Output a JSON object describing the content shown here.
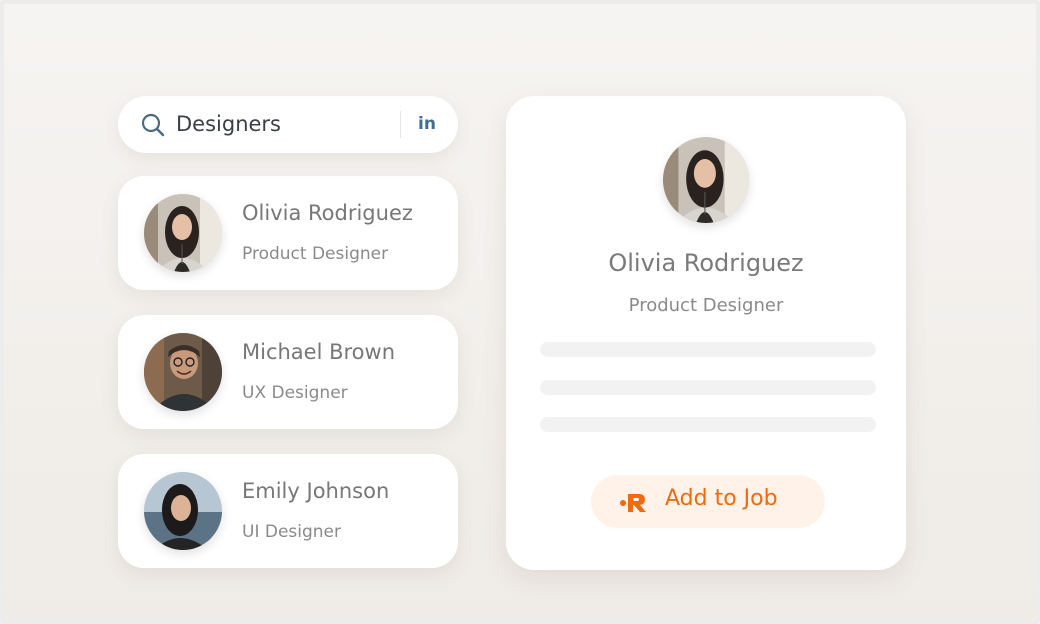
{
  "search": {
    "value": "Designers",
    "placeholder": "Search",
    "linkedin_label": "in"
  },
  "candidates": [
    {
      "name": "Olivia Rodriguez",
      "role": "Product Designer",
      "avatar": "woman-long-dark-hair-avatar"
    },
    {
      "name": "Michael Brown",
      "role": "UX Designer",
      "avatar": "man-glasses-smiling-avatar"
    },
    {
      "name": "Emily Johnson",
      "role": "UI Designer",
      "avatar": "woman-dark-hair-outdoor-avatar"
    }
  ],
  "profile": {
    "name": "Olivia Rodriguez",
    "role": "Product Designer",
    "avatar": "woman-long-dark-hair-avatar",
    "add_label": "Add to Job"
  },
  "colors": {
    "accent": "#f06a0f",
    "accent_bg": "#fff2e8",
    "linkedin": "#3f6e8f",
    "background": "#f3f0ec"
  },
  "icons": {
    "search": "search-icon",
    "linkedin": "linkedin-icon",
    "add": "recruit-logo-icon"
  }
}
